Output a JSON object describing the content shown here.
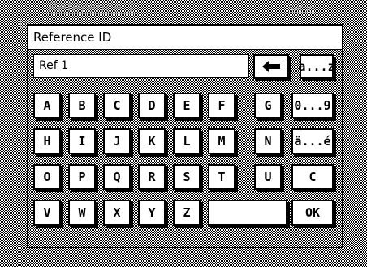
{
  "background": {
    "title": "Reference 1",
    "setup_label": "Setup"
  },
  "dialog": {
    "title": "Reference ID",
    "input_value": "Ref 1",
    "backspace_icon": "left-arrow-icon",
    "keys": {
      "row1": [
        "A",
        "B",
        "C",
        "D",
        "E",
        "F",
        "G"
      ],
      "row2": [
        "H",
        "I",
        "J",
        "K",
        "L",
        "M",
        "N"
      ],
      "row3": [
        "O",
        "P",
        "Q",
        "R",
        "S",
        "T",
        "U"
      ],
      "row4": [
        "V",
        "W",
        "X",
        "Y",
        "Z"
      ],
      "mode_letters": "a...z",
      "mode_digits": "0...9",
      "mode_accents": "ä...é",
      "clear": "C",
      "ok": "OK"
    }
  }
}
